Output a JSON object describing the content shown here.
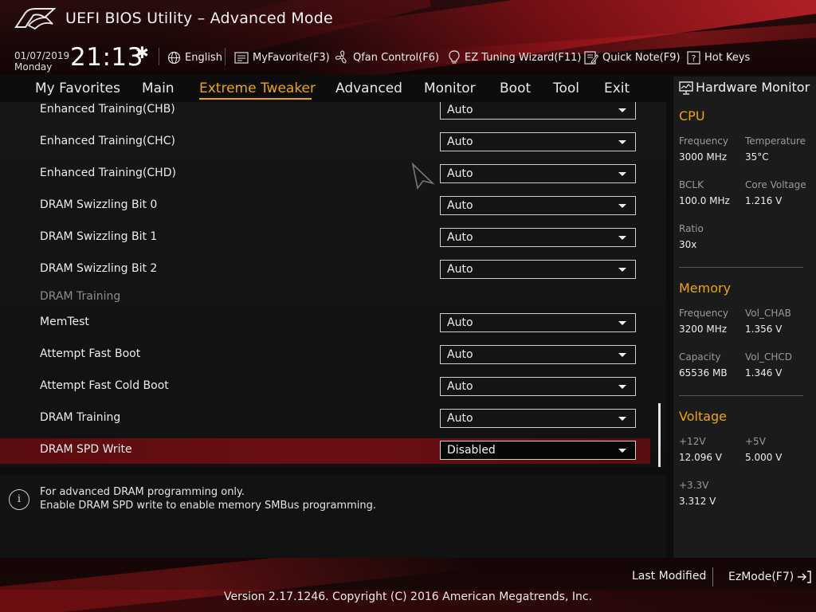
{
  "header": {
    "title": "UEFI BIOS Utility – Advanced Mode",
    "date": "01/07/2019",
    "weekday": "Monday",
    "time": "21:13",
    "toolbar": {
      "language": "English",
      "myfavorite": "MyFavorite(F3)",
      "qfan": "Qfan Control(F6)",
      "ez_tuning": "EZ Tuning Wizard(F11)",
      "quick_note": "Quick Note(F9)",
      "hot_keys": "Hot Keys"
    }
  },
  "tabs": {
    "my_favorites": "My Favorites",
    "main": "Main",
    "extreme_tweaker": "Extreme Tweaker",
    "advanced": "Advanced",
    "monitor": "Monitor",
    "boot": "Boot",
    "tool": "Tool",
    "exit": "Exit",
    "active": "Extreme Tweaker"
  },
  "settings": [
    {
      "label": "Enhanced Training(CHB)",
      "value": "Auto"
    },
    {
      "label": "Enhanced Training(CHC)",
      "value": "Auto"
    },
    {
      "label": "Enhanced Training(CHD)",
      "value": "Auto"
    },
    {
      "label": "DRAM Swizzling Bit 0",
      "value": "Auto"
    },
    {
      "label": "DRAM Swizzling Bit 1",
      "value": "Auto"
    },
    {
      "label": "DRAM Swizzling Bit 2",
      "value": "Auto"
    },
    {
      "label": "DRAM Training",
      "value": null
    },
    {
      "label": "MemTest",
      "value": "Auto"
    },
    {
      "label": "Attempt Fast Boot",
      "value": "Auto"
    },
    {
      "label": "Attempt Fast Cold Boot",
      "value": "Auto"
    },
    {
      "label": "DRAM Training",
      "value": "Auto"
    },
    {
      "label": "DRAM SPD Write",
      "value": "Disabled"
    }
  ],
  "help": {
    "line1": "For advanced DRAM programming only.",
    "line2": "Enable DRAM SPD write to enable memory SMBus programming."
  },
  "hardware_monitor": {
    "title": "Hardware Monitor",
    "cpu": {
      "title": "CPU",
      "frequency_label": "Frequency",
      "frequency": "3000 MHz",
      "temperature_label": "Temperature",
      "temperature": "35°C",
      "bclk_label": "BCLK",
      "bclk": "100.0 MHz",
      "core_voltage_label": "Core Voltage",
      "core_voltage": "1.216 V",
      "ratio_label": "Ratio",
      "ratio": "30x"
    },
    "memory": {
      "title": "Memory",
      "frequency_label": "Frequency",
      "frequency": "3200 MHz",
      "vol_chab_label": "Vol_CHAB",
      "vol_chab": "1.356 V",
      "capacity_label": "Capacity",
      "capacity": "65536 MB",
      "vol_chcd_label": "Vol_CHCD",
      "vol_chcd": "1.346 V"
    },
    "voltage": {
      "title": "Voltage",
      "v12_label": "+12V",
      "v12": "12.096 V",
      "v5_label": "+5V",
      "v5": "5.000 V",
      "v33_label": "+3.3V",
      "v33": "3.312 V"
    }
  },
  "footer": {
    "last_modified": "Last Modified",
    "ezmode": "EzMode(F7)",
    "version": "Version 2.17.1246. Copyright (C) 2016 American Megatrends, Inc."
  },
  "colors": {
    "accent": "#f0a500",
    "highlight_row": "#6a1015",
    "background": "#111111"
  }
}
